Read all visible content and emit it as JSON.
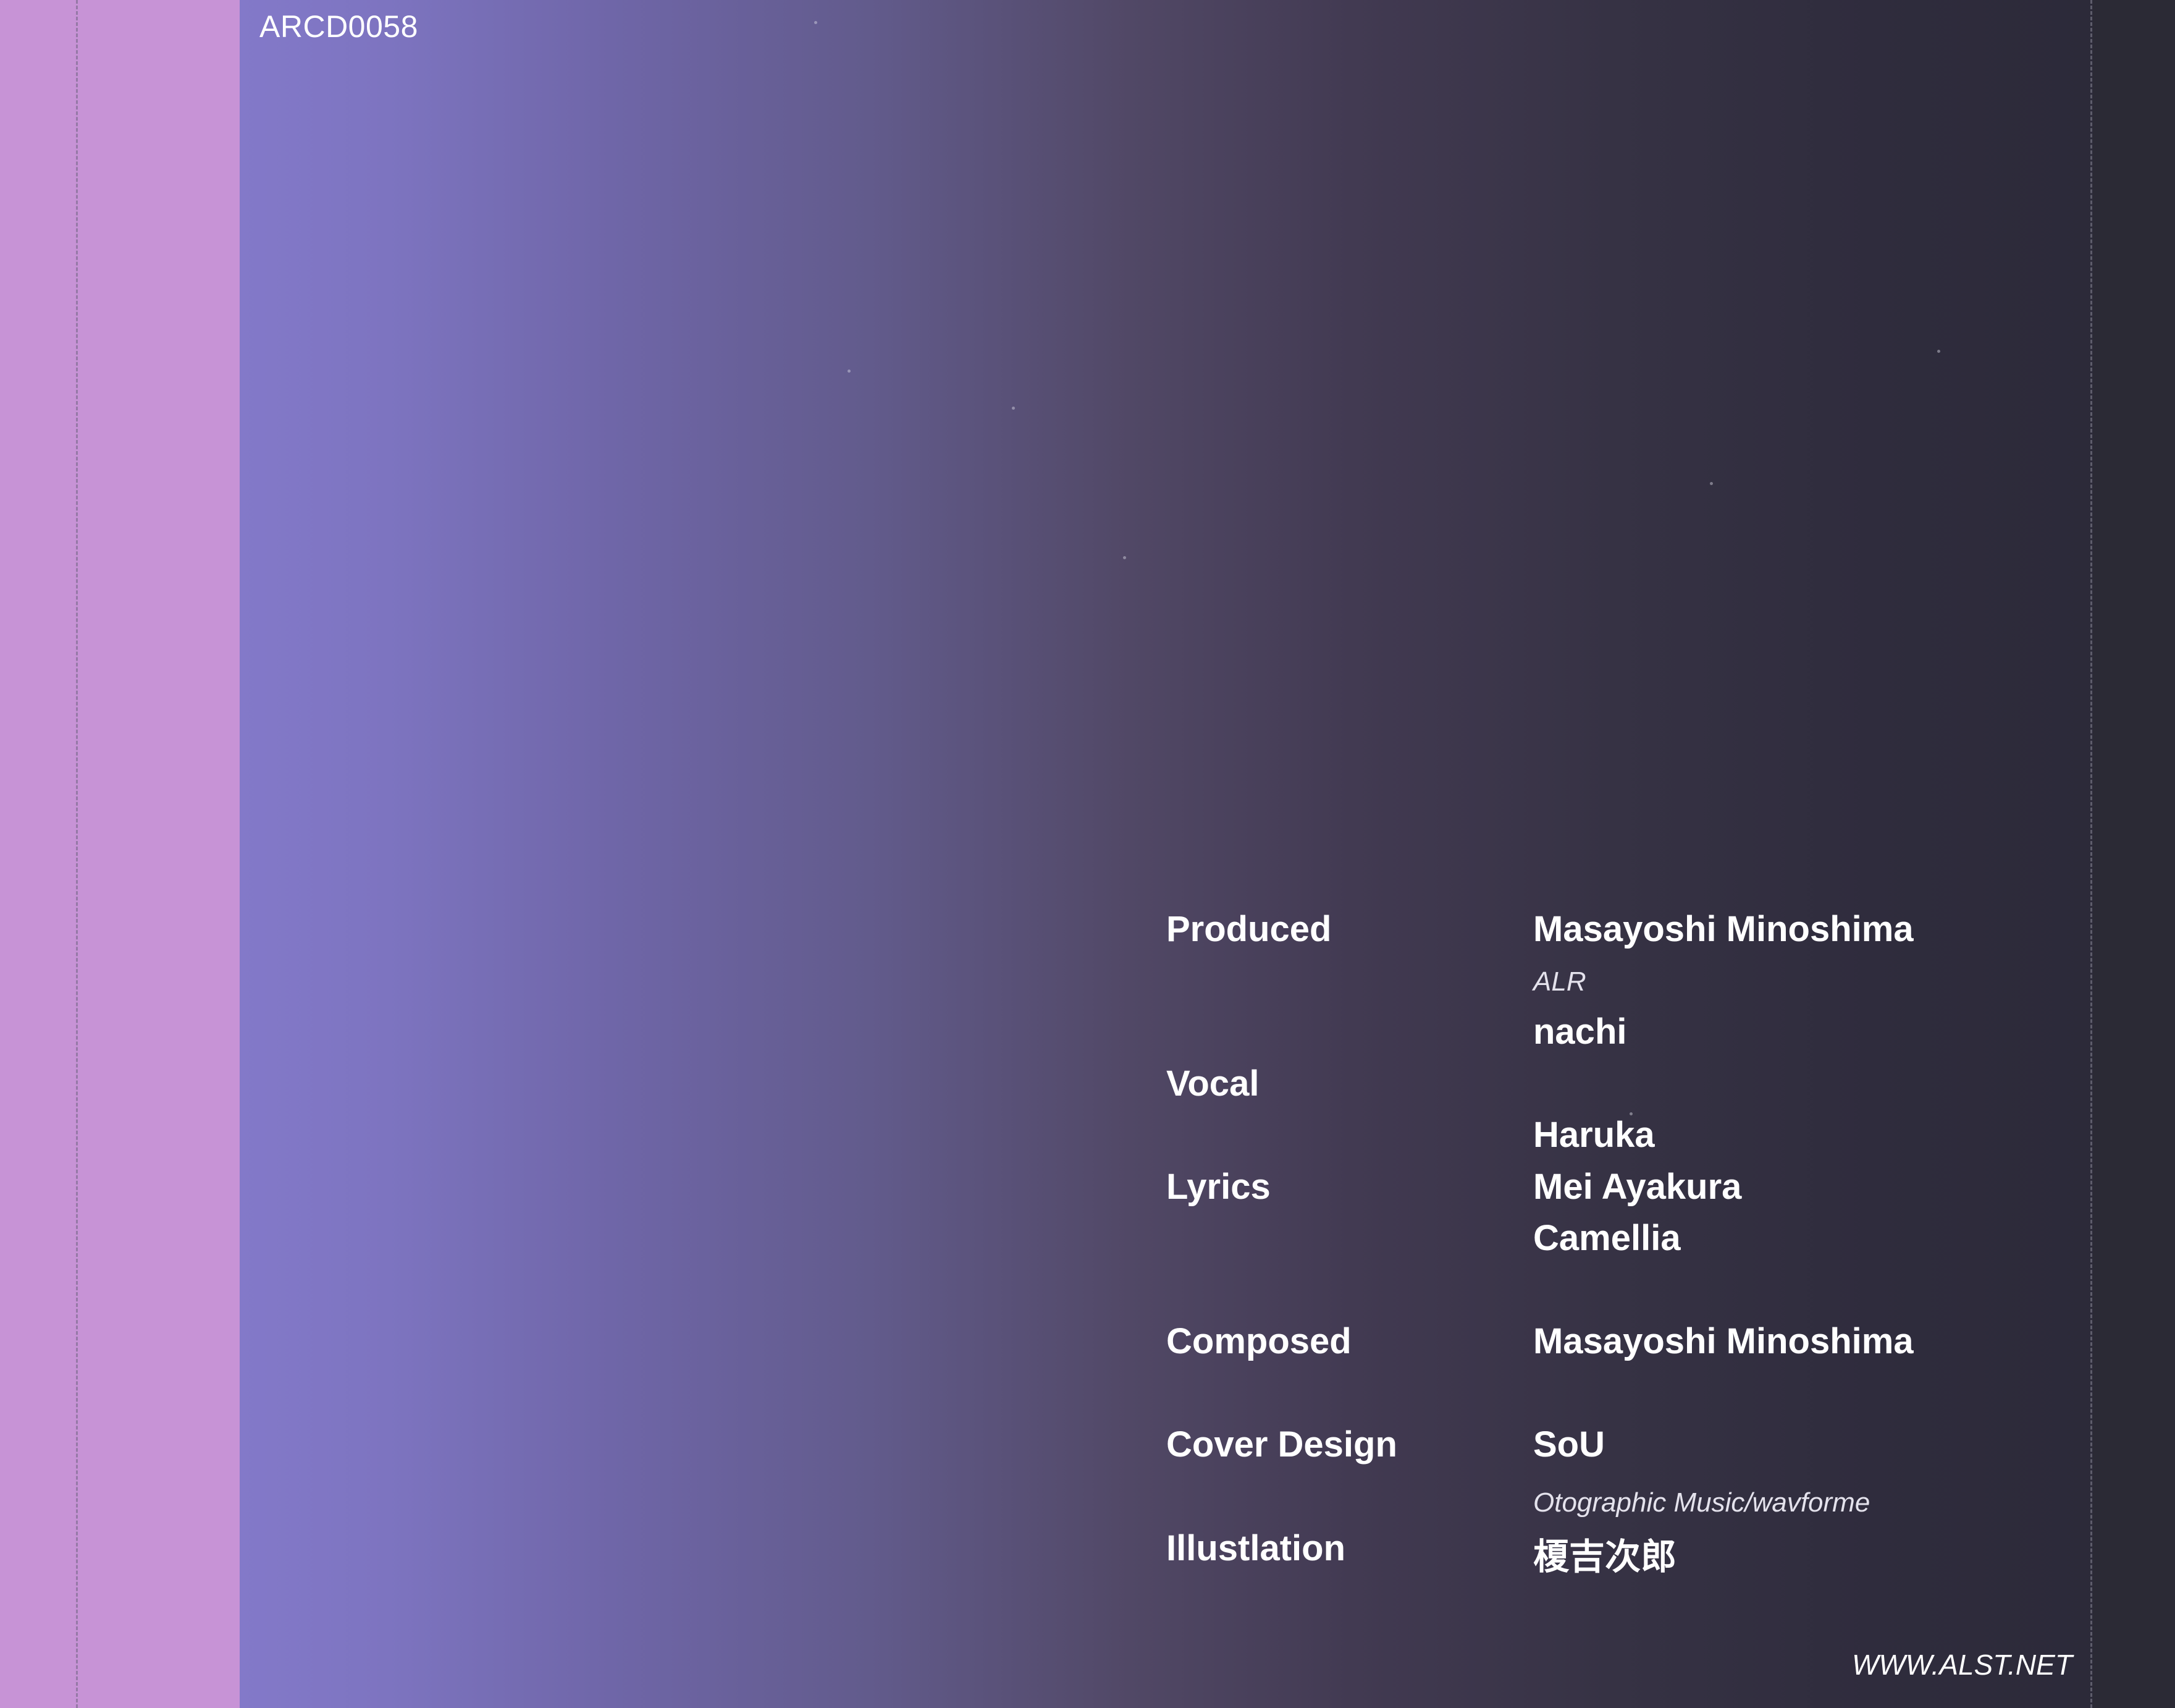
{
  "catalog_number": "ARCD0058",
  "credits": {
    "produced_label": "Produced",
    "produced_name": "Masayoshi Minoshima",
    "produced_affiliation": "ALR",
    "vocal_label": "Vocal",
    "vocal_name": "nachi",
    "lyrics_label": "Lyrics",
    "lyrics_names": [
      "Haruka",
      "Mei Ayakura",
      "Camellia"
    ],
    "composed_label": "Composed",
    "composed_name": "Masayoshi Minoshima",
    "cover_design_label": "Cover Design",
    "cover_design_name": "SoU",
    "cover_design_affiliation": "Otographic Music/wavforme",
    "illustration_label": "Illustlation",
    "illustration_name": "榎吉次郎"
  },
  "website": "WWW.ALST.NET",
  "colors": {
    "spine_left": "#c793d6",
    "gradient_start": "#8379c9",
    "gradient_end": "#2c2a39",
    "text": "#ffffff"
  }
}
